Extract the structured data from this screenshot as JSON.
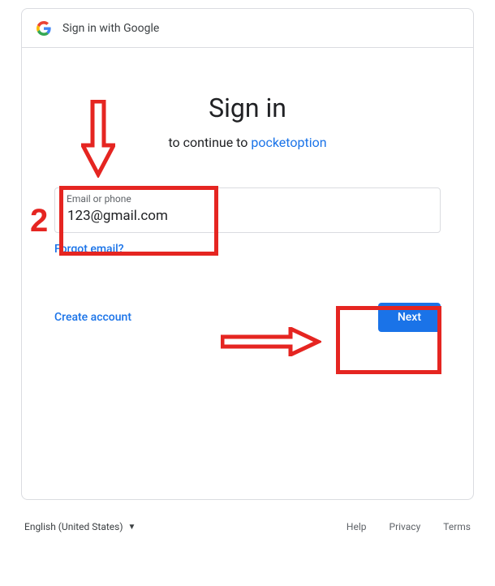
{
  "header": {
    "title": "Sign in with Google"
  },
  "main": {
    "heading": "Sign in",
    "subheading_prefix": "to continue to ",
    "app_name": "pocketoption",
    "email_label": "Email or phone",
    "email_value": "123@gmail.com",
    "forgot_email": "Forgot email?",
    "create_account": "Create account",
    "next": "Next"
  },
  "footer": {
    "language": "English (United States)",
    "links": {
      "help": "Help",
      "privacy": "Privacy",
      "terms": "Terms"
    }
  },
  "annotations": {
    "step_number": "2"
  }
}
